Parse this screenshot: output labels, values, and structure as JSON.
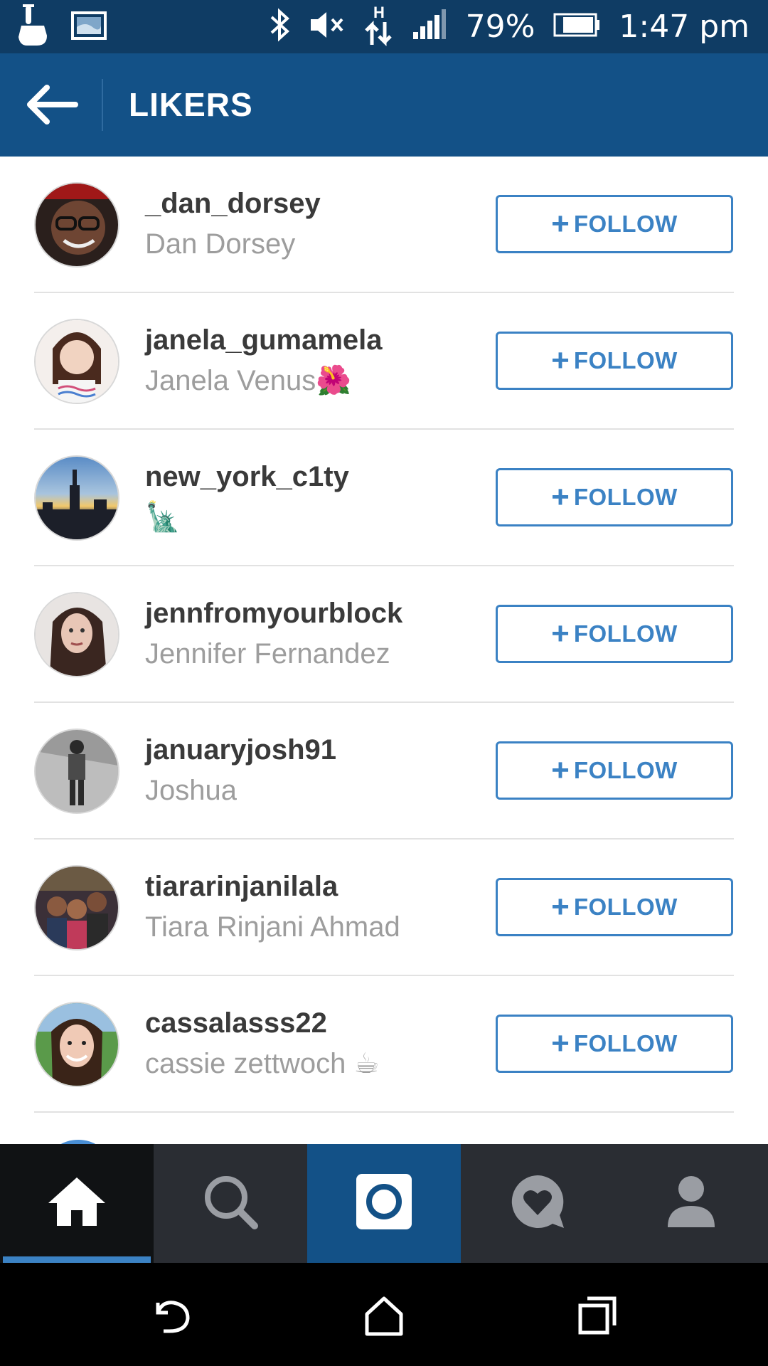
{
  "status_bar": {
    "battery": "79%",
    "time": "1:47 pm",
    "icons": [
      "touch-icon",
      "gallery-icon",
      "bluetooth-icon",
      "mute-icon",
      "hspa-data-icon",
      "signal-icon",
      "battery-icon"
    ]
  },
  "header": {
    "title": "LIKERS",
    "back_icon": "arrow-left-icon"
  },
  "likers": [
    {
      "username": "_dan_dorsey",
      "full_name": "Dan Dorsey",
      "emoji": "",
      "button": "FOLLOW"
    },
    {
      "username": "janela_gumamela",
      "full_name": "Janela Venus",
      "emoji": "🌺",
      "button": "FOLLOW"
    },
    {
      "username": "new_york_c1ty",
      "full_name": "",
      "emoji": "🗽",
      "button": "FOLLOW"
    },
    {
      "username": "jennfromyourblock",
      "full_name": "Jennifer Fernandez",
      "emoji": "",
      "button": "FOLLOW"
    },
    {
      "username": "januaryjosh91",
      "full_name": "Joshua",
      "emoji": "",
      "button": "FOLLOW"
    },
    {
      "username": "tiararinjanilala",
      "full_name": "Tiara Rinjani Ahmad",
      "emoji": "",
      "button": "FOLLOW"
    },
    {
      "username": "cassalasss22",
      "full_name": "cassie zettwoch",
      "emoji": "☕",
      "button": "FOLLOW"
    }
  ],
  "bottom_nav": {
    "tabs": [
      "home-icon",
      "search-icon",
      "camera-icon",
      "activity-icon",
      "profile-icon"
    ],
    "active": "home-icon"
  },
  "system_nav": [
    "back-icon",
    "home-icon",
    "recents-icon"
  ],
  "colors": {
    "status_bar": "#0f3c64",
    "header": "#135187",
    "accent": "#3b82c4",
    "nav_bg": "#2a2d33"
  }
}
